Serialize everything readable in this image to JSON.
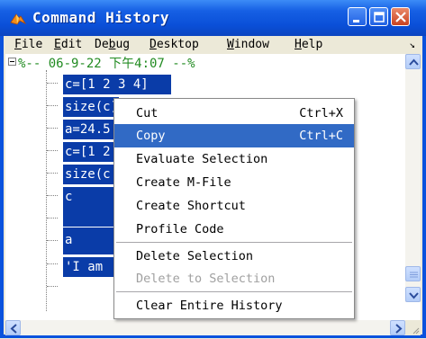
{
  "window": {
    "title": "Command History"
  },
  "menubar": {
    "items": [
      {
        "label": "File",
        "underline": "F"
      },
      {
        "label": "Edit",
        "underline": "E"
      },
      {
        "label": "Debug",
        "underline": "b"
      },
      {
        "label": "Desktop",
        "underline": "D"
      },
      {
        "label": "Window",
        "underline": "W"
      },
      {
        "label": "Help",
        "underline": "H"
      }
    ],
    "dock_arrow": "↘"
  },
  "history": {
    "session_header": "%-- 06-9-22 下午4:07 --%",
    "entries": [
      "c=[1 2 3 4]",
      "size(c)",
      "a=24.5",
      "c=[1 2",
      "size(c",
      "c",
      "a",
      "'I am"
    ]
  },
  "context_menu": {
    "items": [
      {
        "label": "Cut",
        "shortcut": "Ctrl+X",
        "state": "normal"
      },
      {
        "label": "Copy",
        "shortcut": "Ctrl+C",
        "state": "selected"
      },
      {
        "label": "Evaluate Selection",
        "shortcut": "",
        "state": "normal"
      },
      {
        "label": "Create M-File",
        "shortcut": "",
        "state": "normal"
      },
      {
        "label": "Create Shortcut",
        "shortcut": "",
        "state": "normal"
      },
      {
        "label": "Profile Code",
        "shortcut": "",
        "state": "normal"
      },
      {
        "label": "Delete Selection",
        "shortcut": "",
        "state": "normal"
      },
      {
        "label": "Delete to Selection",
        "shortcut": "",
        "state": "disabled"
      },
      {
        "label": "Clear Entire History",
        "shortcut": "",
        "state": "normal"
      }
    ]
  },
  "colors": {
    "titlebar": "#0a52dd",
    "selection": "#0a3ca8",
    "menu_highlight": "#316ac5",
    "session_header": "#228b22"
  }
}
